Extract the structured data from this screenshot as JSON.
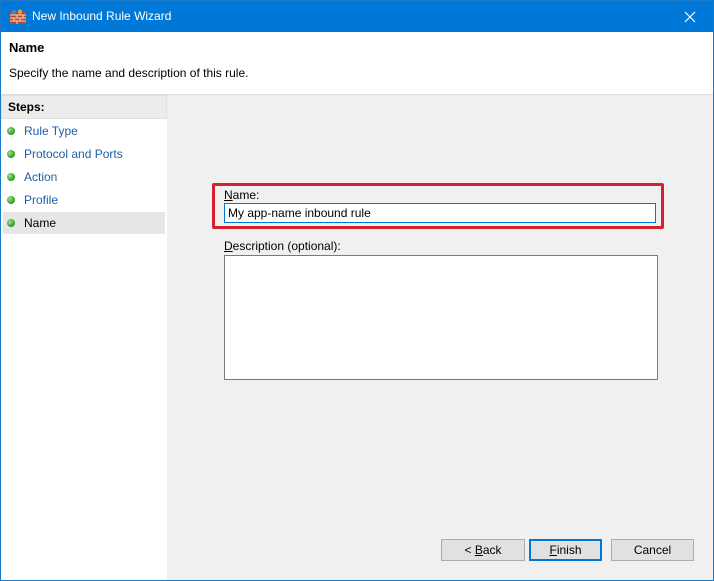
{
  "window": {
    "title": "New Inbound Rule Wizard",
    "icons": {
      "app": "firewall-icon",
      "close": "close-icon"
    },
    "accent_color": "#0078d7"
  },
  "header": {
    "heading": "Name",
    "subtitle": "Specify the name and description of this rule."
  },
  "steps": {
    "title": "Steps:",
    "items": [
      {
        "label": "Rule Type",
        "status": "complete"
      },
      {
        "label": "Protocol and Ports",
        "status": "complete"
      },
      {
        "label": "Action",
        "status": "complete"
      },
      {
        "label": "Profile",
        "status": "complete"
      },
      {
        "label": "Name",
        "status": "current"
      }
    ]
  },
  "form": {
    "name_label_mnemonic": "N",
    "name_label_rest": "ame:",
    "name_value": "My app-name inbound rule",
    "description_label_mnemonic": "D",
    "description_label_rest": "escription (optional):",
    "description_value": "",
    "highlight_color": "#d6202b"
  },
  "buttons": {
    "back_prefix": "< ",
    "back_mnemonic": "B",
    "back_rest": "ack",
    "finish_mnemonic": "F",
    "finish_rest": "inish",
    "cancel": "Cancel"
  }
}
